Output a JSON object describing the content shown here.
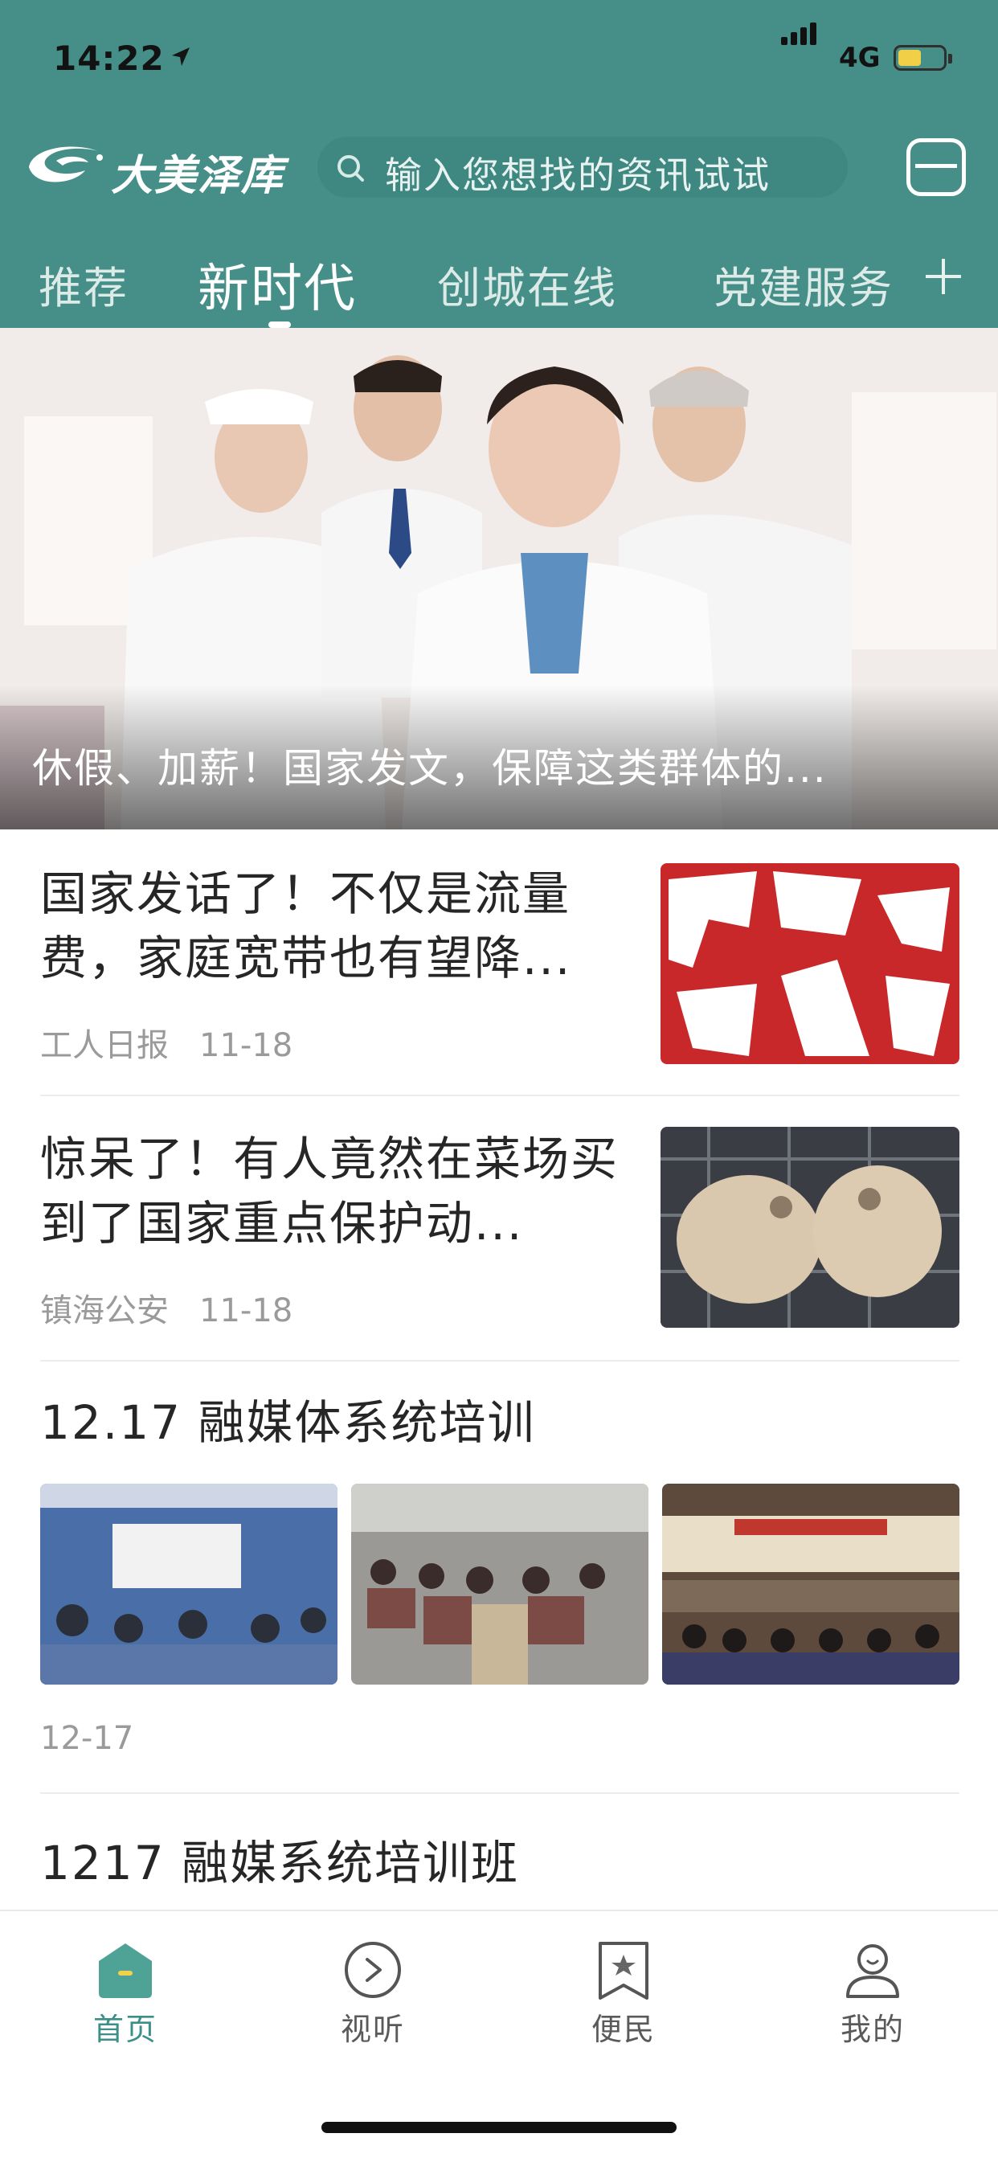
{
  "status_bar": {
    "time": "14:22",
    "network": "4G"
  },
  "header": {
    "logo_text": "大美泽库",
    "search_placeholder": "输入您想找的资讯试试"
  },
  "tabs": [
    {
      "label": "推荐",
      "active": false
    },
    {
      "label": "新时代",
      "active": true
    },
    {
      "label": "创城在线",
      "active": false
    },
    {
      "label": "党建服务",
      "active": false
    }
  ],
  "banner": {
    "caption": "休假、加薪！国家发文，保障这类群体的..."
  },
  "news": [
    {
      "title": "国家发话了！不仅是流量费，家庭宽带也有望降...",
      "source": "工人日报",
      "date": "11-18"
    },
    {
      "title": "惊呆了！有人竟然在菜场买到了国家重点保护动...",
      "source": "镇海公安",
      "date": "11-18"
    }
  ],
  "gallery_item": {
    "title": "12.17 融媒体系统培训",
    "date": "12-17"
  },
  "next_item": {
    "title": "1217 融媒系统培训班"
  },
  "tabbar": [
    {
      "label": "首页",
      "icon": "home-icon",
      "active": true
    },
    {
      "label": "视听",
      "icon": "play-circle-icon",
      "active": false
    },
    {
      "label": "便民",
      "icon": "bookmark-star-icon",
      "active": false
    },
    {
      "label": "我的",
      "icon": "user-icon",
      "active": false
    }
  ],
  "colors": {
    "header_bg": "#468f88",
    "accent": "#3b8f86",
    "text": "#262626",
    "meta": "#9a9a9a"
  }
}
